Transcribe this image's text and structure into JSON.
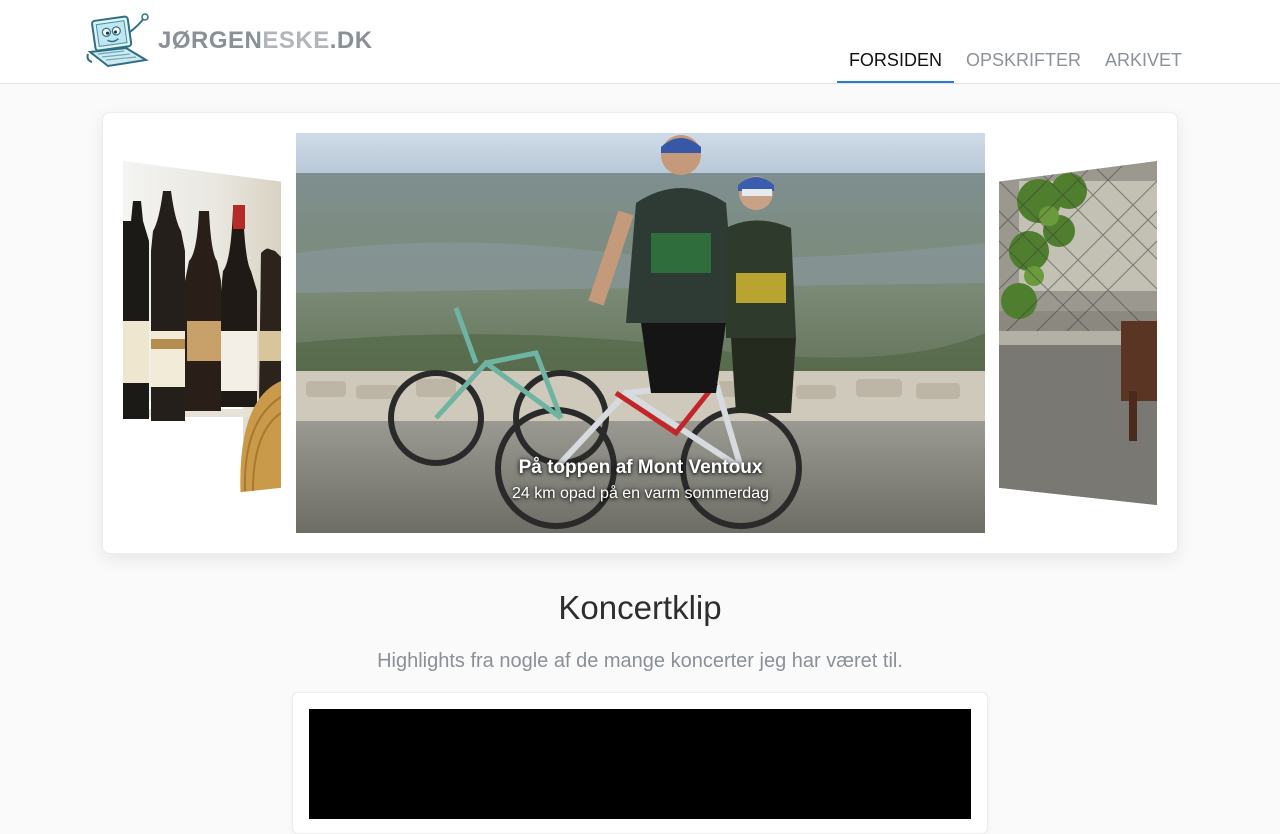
{
  "site": {
    "logo_text": {
      "part1": "JØRGEN",
      "part2": "ESKE",
      "part3": ".DK"
    }
  },
  "nav": {
    "items": [
      {
        "label": "FORSIDEN",
        "active": true
      },
      {
        "label": "OPSKRIFTER",
        "active": false
      },
      {
        "label": "ARKIVET",
        "active": false
      }
    ]
  },
  "carousel": {
    "caption_title": "På toppen af Mont Ventoux",
    "caption_subtitle": "24 km opad på en varm sommerdag",
    "slides": [
      "wine-bottles",
      "cyclists-mont-ventoux",
      "garden-fence"
    ]
  },
  "section": {
    "title": "Koncertklip",
    "subtitle": "Highlights fra nogle af de mange koncerter jeg har været til."
  },
  "colors": {
    "accent": "#2b7bd4",
    "nav_text": "#8b9299",
    "nav_active": "#111111",
    "title": "#2e2e2e",
    "muted": "#8a9097"
  }
}
